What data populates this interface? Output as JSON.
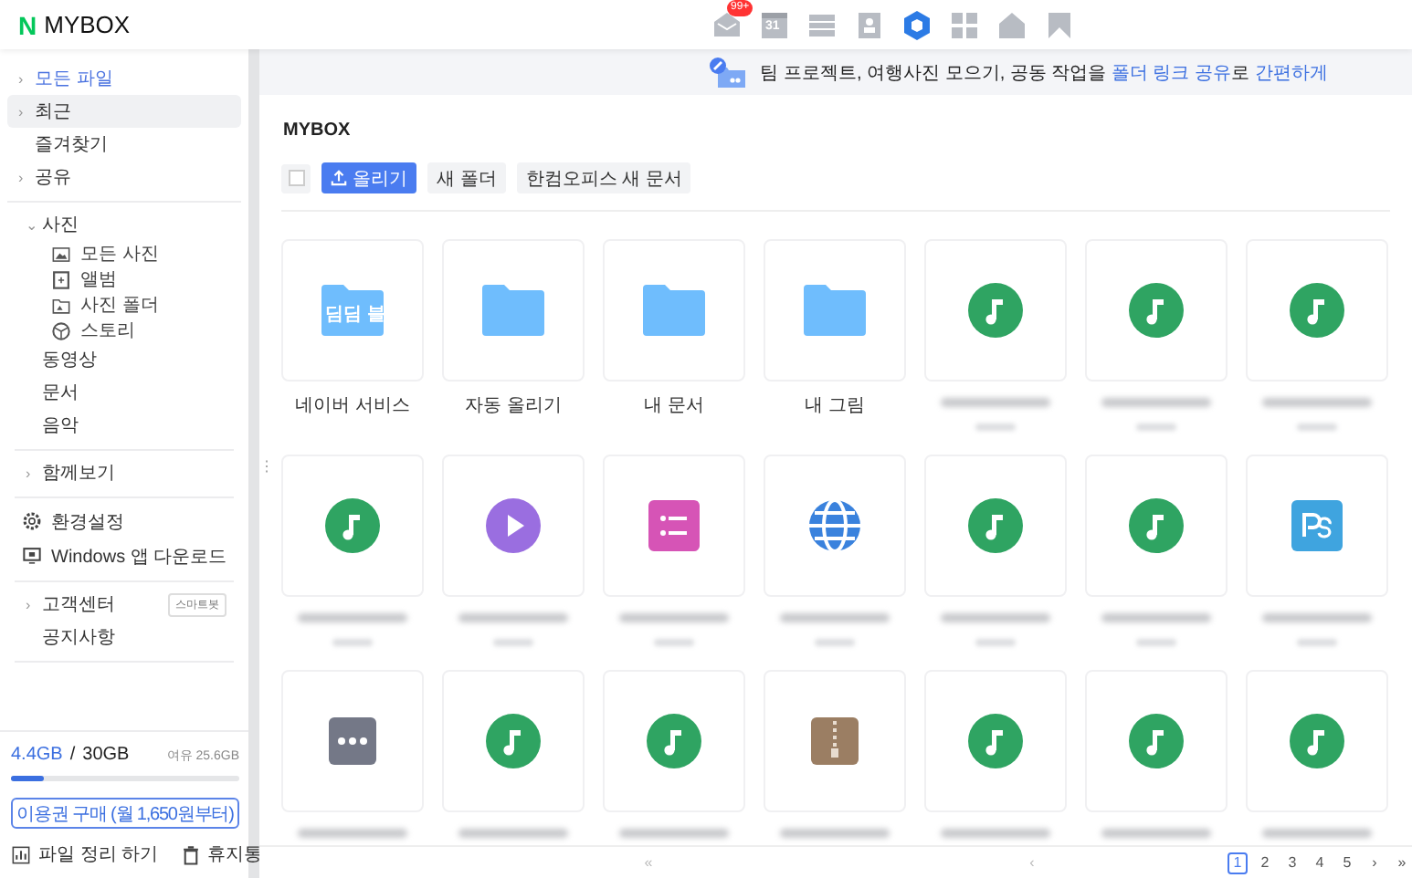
{
  "header": {
    "logo_mark": "N",
    "logo_text": "MYBOX",
    "apps": [
      {
        "kind": "mail",
        "badge": "99+",
        "selected": false
      },
      {
        "kind": "calendar",
        "text": "31",
        "selected": false
      },
      {
        "kind": "list",
        "selected": false
      },
      {
        "kind": "contact",
        "selected": false
      },
      {
        "kind": "mybox",
        "selected": true
      },
      {
        "kind": "apps",
        "selected": false
      },
      {
        "kind": "home",
        "selected": false
      },
      {
        "kind": "bookmark",
        "selected": false
      }
    ]
  },
  "sidebar": {
    "groups": [
      {
        "items": [
          {
            "label": "모든 파일",
            "caret": "›",
            "current": true,
            "selected": false
          },
          {
            "label": "최근",
            "caret": "›",
            "current": false,
            "selected": true
          },
          {
            "label": "즐겨찾기",
            "current": false,
            "selected": false
          },
          {
            "label": "공유",
            "caret": "›",
            "current": false,
            "selected": false
          }
        ]
      },
      {
        "items": [
          {
            "label": "사진",
            "caret": "⌄",
            "current": false,
            "selected": false,
            "children": [
              {
                "label": "모든 사진",
                "kind": "image",
                "selected": false
              },
              {
                "label": "앨범",
                "kind": "album",
                "selected": false
              },
              {
                "label": "사진 폴더",
                "kind": "folder",
                "selected": false
              },
              {
                "label": "스토리",
                "kind": "story",
                "selected": false
              }
            ]
          },
          {
            "label": "동영상",
            "current": false,
            "selected": false
          },
          {
            "label": "문서",
            "current": false,
            "selected": false
          },
          {
            "label": "음악",
            "current": false,
            "selected": false
          }
        ]
      },
      {
        "items": [
          {
            "label": "함께보기",
            "caret": "›",
            "current": false,
            "selected": false
          }
        ]
      },
      {
        "tools": [
          {
            "label": "환경설정",
            "kind": "settings"
          },
          {
            "label": "Windows 앱 다운로드",
            "kind": "monitor"
          }
        ]
      },
      {
        "items": [
          {
            "label": "고객센터",
            "caret": "›",
            "current": false,
            "selected": false,
            "badge": "스마트봇"
          },
          {
            "label": "공지사항",
            "current": false,
            "selected": false
          }
        ]
      }
    ],
    "resize_handle": "⋮",
    "storage": {
      "used": "4.4GB",
      "separator": "/",
      "total": "30GB",
      "free": "여유 25.6GB",
      "level": 0.147,
      "button": {
        "label": "이용권 구매",
        "note": "(월 1,650원부터)"
      },
      "actions": [
        {
          "label": "파일 정리 하기",
          "kind": "chart"
        },
        {
          "label": "휴지통",
          "kind": "trash"
        }
      ]
    }
  },
  "banner": {
    "segments": [
      {
        "text": "팀 프로젝트, 여행사진 모으기, 공동 작업을 ",
        "highlight": false
      },
      {
        "text": "폴더 링크 공유",
        "highlight": true
      },
      {
        "text": "로 ",
        "highlight": false
      },
      {
        "text": "간편하게",
        "highlight": true
      }
    ]
  },
  "title": "MYBOX",
  "toolbar": {
    "select_all": {
      "checked": false
    },
    "buttons": [
      {
        "label": "올리기",
        "kind": "primary"
      },
      {
        "label": "새 폴더",
        "kind": "plain"
      },
      {
        "label": "한컴오피스 새 문서",
        "kind": "plain"
      }
    ]
  },
  "files": [
    {
      "kind": "folder",
      "name": "네이버 서비스",
      "badge": "딤딤 블"
    },
    {
      "kind": "folder",
      "name": "자동 올리기"
    },
    {
      "kind": "folder",
      "name": "내 문서"
    },
    {
      "kind": "folder",
      "name": "내 그림"
    },
    {
      "kind": "audio"
    },
    {
      "kind": "audio"
    },
    {
      "kind": "audio"
    },
    {
      "kind": "audio"
    },
    {
      "kind": "video"
    },
    {
      "kind": "document"
    },
    {
      "kind": "web"
    },
    {
      "kind": "audio"
    },
    {
      "kind": "audio"
    },
    {
      "kind": "photoshop"
    },
    {
      "kind": "other"
    },
    {
      "kind": "audio"
    },
    {
      "kind": "audio"
    },
    {
      "kind": "archive"
    },
    {
      "kind": "audio"
    },
    {
      "kind": "audio"
    },
    {
      "kind": "audio"
    }
  ],
  "pager": {
    "first": "«",
    "prev": "‹",
    "pages": [
      {
        "label": "1",
        "selected": true
      },
      {
        "label": "2",
        "selected": false
      },
      {
        "label": "3",
        "selected": false
      },
      {
        "label": "4",
        "selected": false
      },
      {
        "label": "5",
        "selected": false
      }
    ],
    "next": "›",
    "last": "»"
  }
}
